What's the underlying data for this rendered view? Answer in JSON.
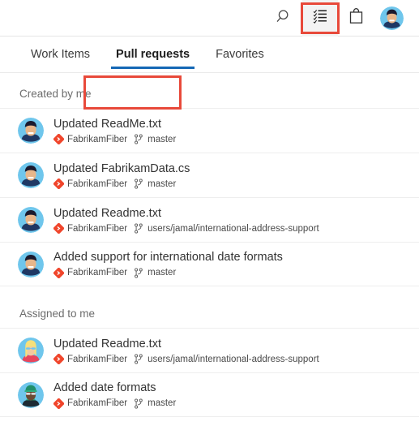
{
  "topbar": {
    "icons": [
      {
        "name": "search-icon",
        "label": "Search"
      },
      {
        "name": "my-work-icon",
        "label": "My work items"
      },
      {
        "name": "marketplace-bag-icon",
        "label": "Marketplace"
      },
      {
        "name": "user-profile-avatar",
        "label": "User profile"
      }
    ],
    "highlight_color": "#e8493a"
  },
  "tabs": [
    {
      "label": "Work Items",
      "selected": false
    },
    {
      "label": "Pull requests",
      "selected": true
    },
    {
      "label": "Favorites",
      "selected": false
    }
  ],
  "accent_color": "#1568b5",
  "sections": [
    {
      "header": "Created by me",
      "items": [
        {
          "title": "Updated ReadMe.txt",
          "repo": "FabrikamFiber",
          "branch": "master",
          "avatar": "man-dark-hair"
        },
        {
          "title": "Updated FabrikamData.cs",
          "repo": "FabrikamFiber",
          "branch": "master",
          "avatar": "man-dark-hair"
        },
        {
          "title": "Updated Readme.txt",
          "repo": "FabrikamFiber",
          "branch": "users/jamal/international-address-support",
          "avatar": "man-dark-hair"
        },
        {
          "title": "Added support for international date formats",
          "repo": "FabrikamFiber",
          "branch": "master",
          "avatar": "man-dark-hair"
        }
      ]
    },
    {
      "header": "Assigned to me",
      "items": [
        {
          "title": "Updated Readme.txt",
          "repo": "FabrikamFiber",
          "branch": "users/jamal/international-address-support",
          "avatar": "woman-blonde-glasses"
        },
        {
          "title": "Added date formats",
          "repo": "FabrikamFiber",
          "branch": "master",
          "avatar": "person-green-cap"
        }
      ]
    }
  ]
}
